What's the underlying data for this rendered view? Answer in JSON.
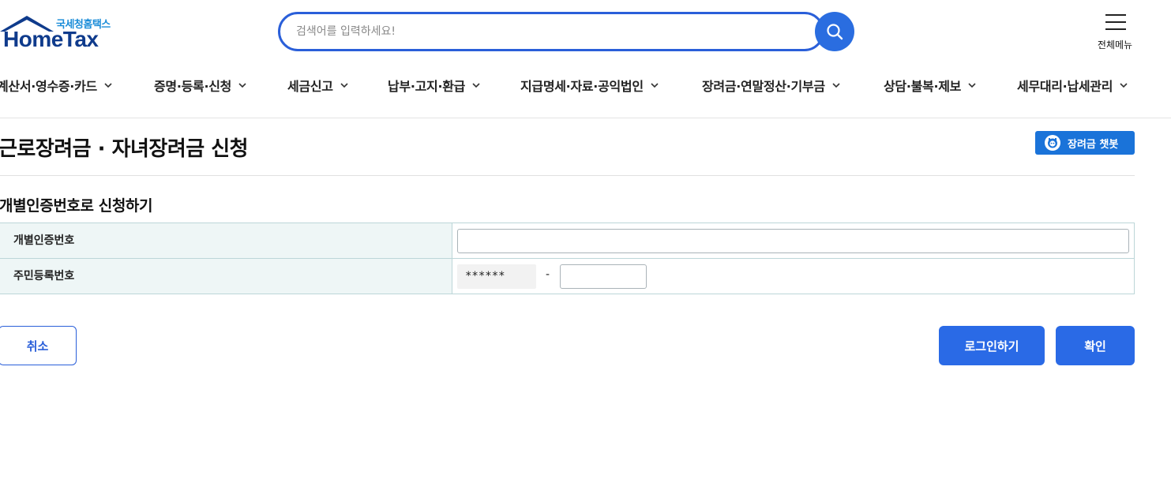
{
  "header": {
    "logo_sub": "국세청홈택스",
    "logo_main": "HomeTax",
    "search_placeholder": "검색어를 입력하세요!",
    "search_value": "",
    "menu_label": "전체메뉴"
  },
  "gnb": [
    {
      "label": "계산서·영수증·카드"
    },
    {
      "label": "증명·등록·신청"
    },
    {
      "label": "세금신고"
    },
    {
      "label": "납부·고지·환급"
    },
    {
      "label": "지급명세·자료·공익법인"
    },
    {
      "label": "장려금·연말정산·기부금"
    },
    {
      "label": "상담·불복·제보"
    },
    {
      "label": "세무대리·납세관리"
    }
  ],
  "page": {
    "title": "근로장려금 · 자녀장려금 신청",
    "chatbot_label": "장려금 챗봇",
    "section_title": "개별인증번호로 신청하기"
  },
  "form": {
    "row1_label": "개별인증번호",
    "row1_value": "",
    "row2_label": "주민등록번호",
    "rrn_front": "******",
    "rrn_dash": "-",
    "rrn_back_value": ""
  },
  "buttons": {
    "cancel": "취소",
    "login": "로그인하기",
    "confirm": "확인"
  },
  "colors": {
    "primary": "#2a6ae6",
    "logo_blue": "#0f3b8c",
    "label_bg": "#eef6f6"
  }
}
